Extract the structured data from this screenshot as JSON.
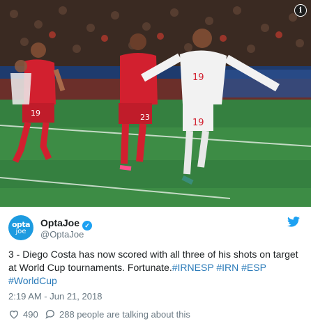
{
  "tweet": {
    "name": "OptaJoe",
    "handle": "@OptaJoe",
    "avatar_top": "opta",
    "avatar_bottom": "joe",
    "text_main": "3 - Diego Costa has now scored with all three of his shots on target at World Cup tournaments. Fortunate.",
    "hashtags": [
      "#IRNESP",
      "#IRN",
      "#ESP",
      "#WorldCup"
    ],
    "timestamp": "2:19 AM - Jun 21, 2018",
    "likes": "490",
    "talking": "288 people are talking about this"
  },
  "photo": {
    "player_left_number": "19",
    "player_mid_number": "23",
    "player_right_number": "19"
  },
  "colors": {
    "brand_blue": "#1da1f2",
    "link": "#2b7bb9",
    "muted": "#697882",
    "spain_shirt": "#f2f2f2",
    "iran_shirt": "#d2202f"
  },
  "icons": [
    "info-icon",
    "verified-icon",
    "twitter-bird-icon",
    "heart-icon",
    "reply-icon"
  ]
}
